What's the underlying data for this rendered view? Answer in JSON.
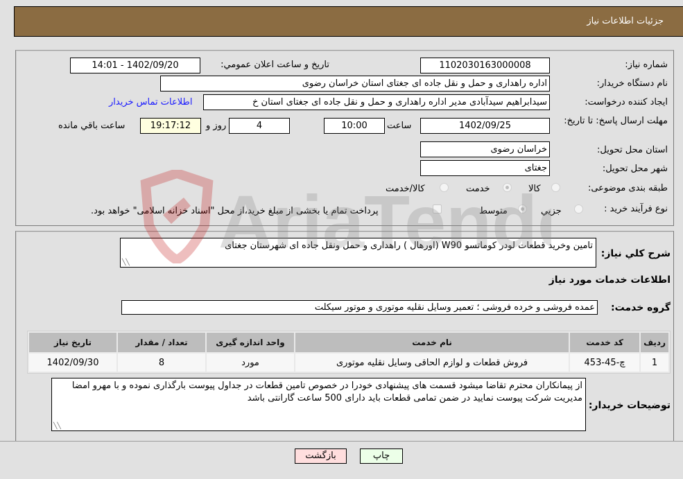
{
  "header": {
    "title": "جزئیات اطلاعات نیاز"
  },
  "details": {
    "need_number": {
      "label": "شماره نیاز:",
      "value": "1102030163000008"
    },
    "announce_datetime": {
      "label": "تاریخ و ساعت اعلان عمومي:",
      "value": "1402/09/20 - 14:01"
    },
    "buyer_org": {
      "label": "نام دستگاه خریدار:",
      "value": "اداره راهداری و حمل و نقل جاده ای جغتای استان خراسان رضوی"
    },
    "requester": {
      "label": "ایجاد کننده درخواست:",
      "value": "سیدابراهیم سیدآبادی مدیر اداره راهداری و حمل و نقل جاده ای جغتای استان خ"
    },
    "buyer_contact_link": "اطلاعات تماس خریدار",
    "deadline": {
      "label": "مهلت ارسال پاسخ: تا تاریخ:",
      "date": "1402/09/25",
      "time_label": "ساعت",
      "time": "10:00",
      "days": "4",
      "days_label": "روز و",
      "remaining": "19:17:12",
      "remaining_label": "ساعت باقي مانده"
    },
    "delivery_province": {
      "label": "استان محل تحویل:",
      "value": "خراسان رضوی"
    },
    "delivery_city": {
      "label": "شهر محل تحویل:",
      "value": "جغتای"
    },
    "category": {
      "label": "طبقه بندی موضوعی:",
      "options": [
        "کالا",
        "خدمت",
        "کالا/خدمت"
      ],
      "selected": "خدمت"
    },
    "purchase_type": {
      "label": "نوع فرآیند خرید :",
      "options": [
        "جزيي",
        "متوسط"
      ],
      "selected": "متوسط",
      "treasury_note": "پرداخت تمام یا بخشی از مبلغ خرید،از محل \"اسناد خزانه اسلامی\" خواهد بود.",
      "treasury_checked": false
    }
  },
  "summary": {
    "label": "شرح کلي نیاز:",
    "value": "تامین وخرید قطعات لودر کوماتسو W90 (اورهال ) راهداری و حمل ونقل جاده ای شهرستان جغتای"
  },
  "services_section_title": "اطلاعات خدمات مورد نیاز",
  "service_group": {
    "label": "گروه خدمت:",
    "value": "عمده فروشی و خرده فروشی ؛ تعمیر وسایل نقلیه موتوری و موتور سیکلت"
  },
  "table": {
    "headers": [
      "ردیف",
      "کد خدمت",
      "نام خدمت",
      "واحد اندازه گیری",
      "تعداد / مقدار",
      "تاریخ نیاز"
    ],
    "rows": [
      [
        "1",
        "چ-45-453",
        "فروش قطعات و لوازم الحاقی وسایل نقلیه موتوری",
        "مورد",
        "8",
        "1402/09/30"
      ]
    ]
  },
  "buyer_notes": {
    "label": "توضیحات خریدار:",
    "value": "از پیمانکاران محترم تقاضا میشود قسمت های پیشنهادی خودرا در خصوص تامین قطعات در جداول پیوست بارگذاری نموده و با مهرو امضا مدیریت شرکت پیوست نمایید  در ضمن تمامی قطعات باید دارای 500 ساعت گارانتی باشد"
  },
  "buttons": {
    "print": "چاپ",
    "back": "بازگشت"
  },
  "watermark": {
    "text": "AriaTender.neT"
  },
  "colors": {
    "header_bg": "#8b6c42",
    "link": "#1a1aff",
    "print_bg": "#ecffe8",
    "back_bg": "#ffdede",
    "remaining_bg": "#ffffe0"
  }
}
